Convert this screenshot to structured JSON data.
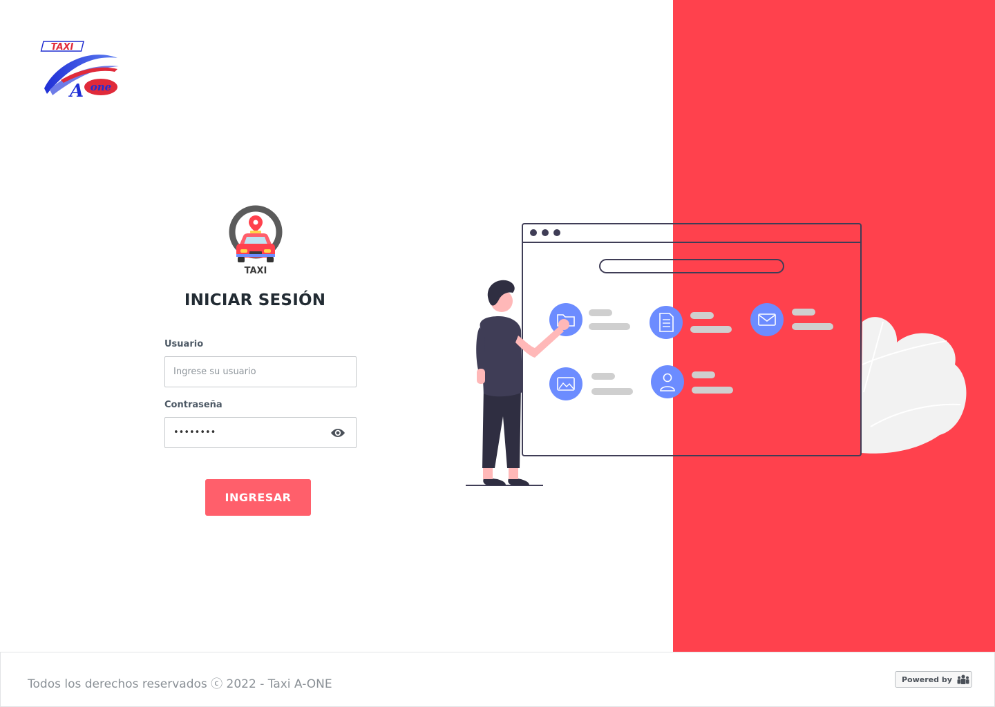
{
  "brand": {
    "logo_top_text": "TAXI",
    "logo_bottom_text": "A-one",
    "primary_color": "#ff414d",
    "button_color": "#ff5f6b",
    "accent_blue": "#6c8cff"
  },
  "badge": {
    "label": "TAXI",
    "icon": "taxi-location-icon"
  },
  "login": {
    "title": "INICIAR SESIÓN",
    "user_label": "Usuario",
    "user_placeholder": "Ingrese su usuario",
    "user_value": "",
    "password_label": "Contraseña",
    "password_value": "********",
    "password_toggle_icon": "eye-icon",
    "submit_label": "INGRESAR"
  },
  "illustration": {
    "window_icons": [
      "folder-icon",
      "document-icon",
      "mail-icon",
      "image-icon",
      "user-icon"
    ]
  },
  "footer": {
    "copyright": "Todos los derechos reservados ⓒ 2022  - Taxi A-ONE",
    "powered_label": "Powered by",
    "powered_icon": "team-icon"
  }
}
